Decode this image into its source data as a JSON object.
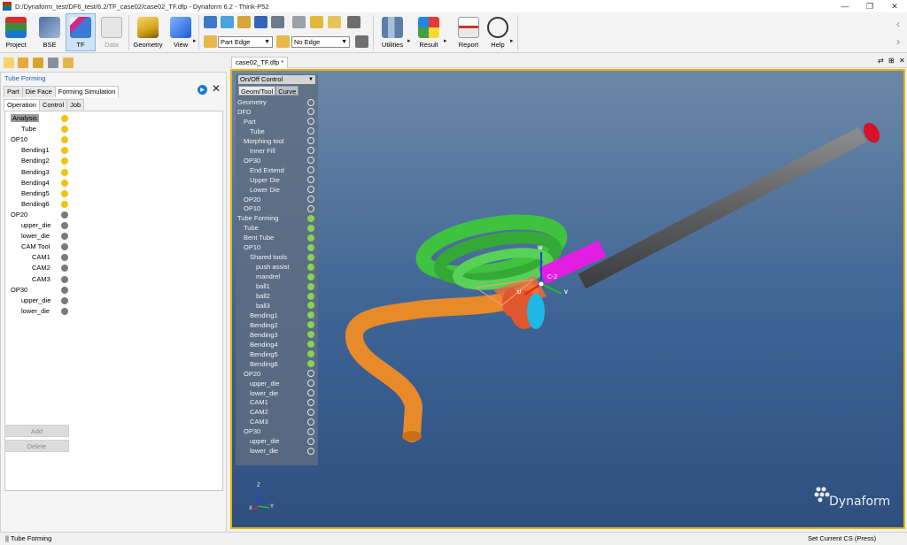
{
  "window": {
    "title": "D:/Dynaform_test/DF6_test/6.2/TF_case02/case02_TF.dfp - Dynaform 6.2  - Think-P52",
    "minimize": "—",
    "restore": "❐",
    "close": "✕"
  },
  "ribbon": {
    "buttons": [
      {
        "label": "Project",
        "icon": "project-icon"
      },
      {
        "label": "BSE",
        "icon": "bse-icon"
      },
      {
        "label": "TF",
        "icon": "tf-icon"
      },
      {
        "label": "Data",
        "icon": "data-icon"
      },
      {
        "label": "Geometry",
        "icon": "geometry-icon"
      },
      {
        "label": "View",
        "icon": "view-icon"
      },
      {
        "label": "Utilities",
        "icon": "utilities-icon"
      },
      {
        "label": "Result",
        "icon": "result-icon"
      },
      {
        "label": "Report",
        "icon": "report-icon"
      },
      {
        "label": "Help",
        "icon": "help-icon"
      }
    ],
    "part_edge_combo": "Part Edge",
    "no_edge_combo": "No Edge",
    "scroll_left": "‹",
    "scroll_right": "›"
  },
  "left_panel": {
    "title": "Tube Forming",
    "tabs": [
      "Part",
      "Die Face",
      "Forming Simulation"
    ],
    "subtabs": [
      "Operation",
      "Control",
      "Job"
    ],
    "tree": [
      {
        "label": "Analysis",
        "level": 0,
        "selected": true,
        "bulb": "sun"
      },
      {
        "label": "Tube",
        "level": 1,
        "bulb": "sun"
      },
      {
        "label": "OP10",
        "level": 0,
        "bulb": "sun"
      },
      {
        "label": "Bending1",
        "level": 1,
        "bulb": "sun"
      },
      {
        "label": "Bending2",
        "level": 1,
        "bulb": "sun"
      },
      {
        "label": "Bending3",
        "level": 1,
        "bulb": "sun"
      },
      {
        "label": "Bending4",
        "level": 1,
        "bulb": "sun"
      },
      {
        "label": "Bending5",
        "level": 1,
        "bulb": "sun"
      },
      {
        "label": "Bending6",
        "level": 1,
        "bulb": "sun"
      },
      {
        "label": "OP20",
        "level": 0,
        "bulb": "off"
      },
      {
        "label": "upper_die",
        "level": 1,
        "bulb": "off"
      },
      {
        "label": "lower_die",
        "level": 1,
        "bulb": "off"
      },
      {
        "label": "CAM Tool",
        "level": 1,
        "bulb": "off"
      },
      {
        "label": "CAM1",
        "level": 2,
        "bulb": "off"
      },
      {
        "label": "CAM2",
        "level": 2,
        "bulb": "off"
      },
      {
        "label": "CAM3",
        "level": 2,
        "bulb": "off"
      },
      {
        "label": "OP30",
        "level": 0,
        "bulb": "off"
      },
      {
        "label": "upper_die",
        "level": 1,
        "bulb": "off"
      },
      {
        "label": "lower_die",
        "level": 1,
        "bulb": "off"
      }
    ],
    "add_button": "Add",
    "delete_button": "Delete"
  },
  "doc_tab": "case02_TF.dfp *",
  "onoff": {
    "header": "On/Off Control",
    "tabs": [
      "Geom/Tool",
      "Curve"
    ],
    "rows": [
      {
        "label": "Geometry",
        "indent": 0,
        "on": false
      },
      {
        "label": "DFD",
        "indent": 0,
        "on": false
      },
      {
        "label": "Part",
        "indent": 1,
        "on": false
      },
      {
        "label": "Tube",
        "indent": 2,
        "on": false
      },
      {
        "label": "Morphing tool",
        "indent": 1,
        "on": false
      },
      {
        "label": "Inner Fill",
        "indent": 2,
        "on": false
      },
      {
        "label": "OP30",
        "indent": 1,
        "on": false
      },
      {
        "label": "End Extend",
        "indent": 2,
        "on": false
      },
      {
        "label": "Upper Die",
        "indent": 2,
        "on": false
      },
      {
        "label": "Lower Die",
        "indent": 2,
        "on": false
      },
      {
        "label": "OP20",
        "indent": 1,
        "on": false
      },
      {
        "label": "OP10",
        "indent": 1,
        "on": false
      },
      {
        "label": "Tube Forming",
        "indent": 0,
        "on": true
      },
      {
        "label": "Tube",
        "indent": 1,
        "on": true
      },
      {
        "label": "Bent Tube",
        "indent": 1,
        "on": true
      },
      {
        "label": "OP10",
        "indent": 1,
        "on": true
      },
      {
        "label": "Shared tools",
        "indent": 2,
        "on": true
      },
      {
        "label": "push assist",
        "indent": 3,
        "on": true
      },
      {
        "label": "mandrel",
        "indent": 3,
        "on": true
      },
      {
        "label": "ball1",
        "indent": 3,
        "on": true
      },
      {
        "label": "ball2",
        "indent": 3,
        "on": true
      },
      {
        "label": "ball3",
        "indent": 3,
        "on": true
      },
      {
        "label": "Bending1",
        "indent": 2,
        "on": true
      },
      {
        "label": "Bending2",
        "indent": 2,
        "on": true
      },
      {
        "label": "Bending3",
        "indent": 2,
        "on": true
      },
      {
        "label": "Bending4",
        "indent": 2,
        "on": true
      },
      {
        "label": "Bending5",
        "indent": 2,
        "on": true
      },
      {
        "label": "Bending6",
        "indent": 2,
        "on": true
      },
      {
        "label": "OP20",
        "indent": 1,
        "on": false
      },
      {
        "label": "upper_die",
        "indent": 2,
        "on": false
      },
      {
        "label": "lower_die",
        "indent": 2,
        "on": false
      },
      {
        "label": "CAM1",
        "indent": 2,
        "on": false
      },
      {
        "label": "CAM2",
        "indent": 2,
        "on": false
      },
      {
        "label": "CAM3",
        "indent": 2,
        "on": false
      },
      {
        "label": "OP30",
        "indent": 1,
        "on": false
      },
      {
        "label": "upper_die",
        "indent": 2,
        "on": false
      },
      {
        "label": "lower_die",
        "indent": 2,
        "on": false
      }
    ]
  },
  "viewport": {
    "cs_label": "C-2",
    "axis_w": "W",
    "axis_u": "U",
    "axis_v": "V",
    "triad_z": "Z",
    "triad_x": "X",
    "triad_y": "Y",
    "brand": "Dynaform"
  },
  "status": {
    "left": "|| Tube Forming",
    "right": "Set Current CS (Press)"
  },
  "colors": {
    "tube_orange": "#e98a2a",
    "tube_gray": "#5f6062",
    "tube_end_red": "#d8102a",
    "magenta_tool": "#e21ee2",
    "green_tool": "#3fc23f",
    "cyan_ball": "#1fb8e6",
    "red_ball": "#e0572f",
    "viewport_border": "#e6b400",
    "switch_on": "#89d353"
  }
}
